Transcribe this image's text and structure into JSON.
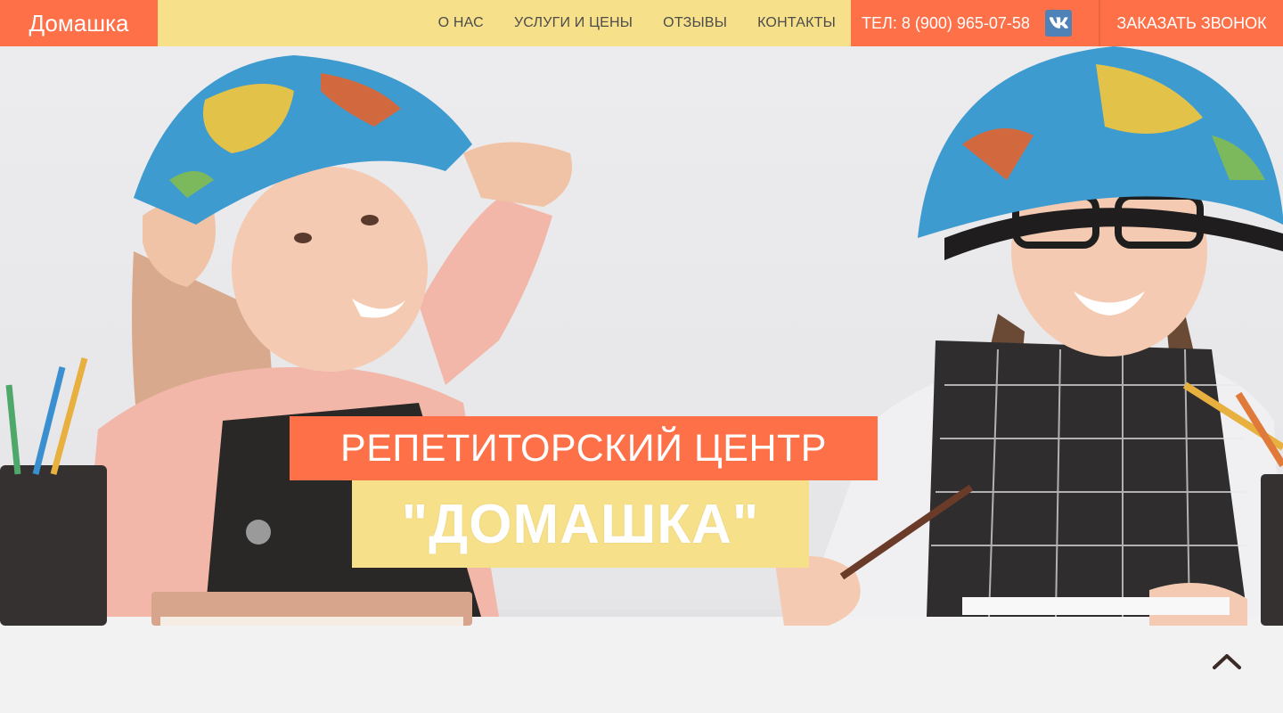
{
  "header": {
    "logo": "Домашка",
    "nav": [
      {
        "label": "О НАС"
      },
      {
        "label": "УСЛУГИ И ЦЕНЫ"
      },
      {
        "label": "ОТЗЫВЫ"
      },
      {
        "label": "КОНТАКТЫ"
      }
    ],
    "phone": "ТЕЛ: 8 (900) 965-07-58",
    "vk_icon": "vk-icon",
    "callback_label": "ЗАКАЗАТЬ ЗВОНОК"
  },
  "hero": {
    "title_line1": "РЕПЕТИТОРСКИЙ ЦЕНТР",
    "title_line2": "\"ДОМАШКА\"",
    "scroll_icon": "chevron-up-icon"
  },
  "colors": {
    "accent_orange": "#fd7048",
    "accent_yellow": "#f7e08a",
    "nav_text": "#4c4c4c",
    "vk_blue": "#4f82b6"
  }
}
